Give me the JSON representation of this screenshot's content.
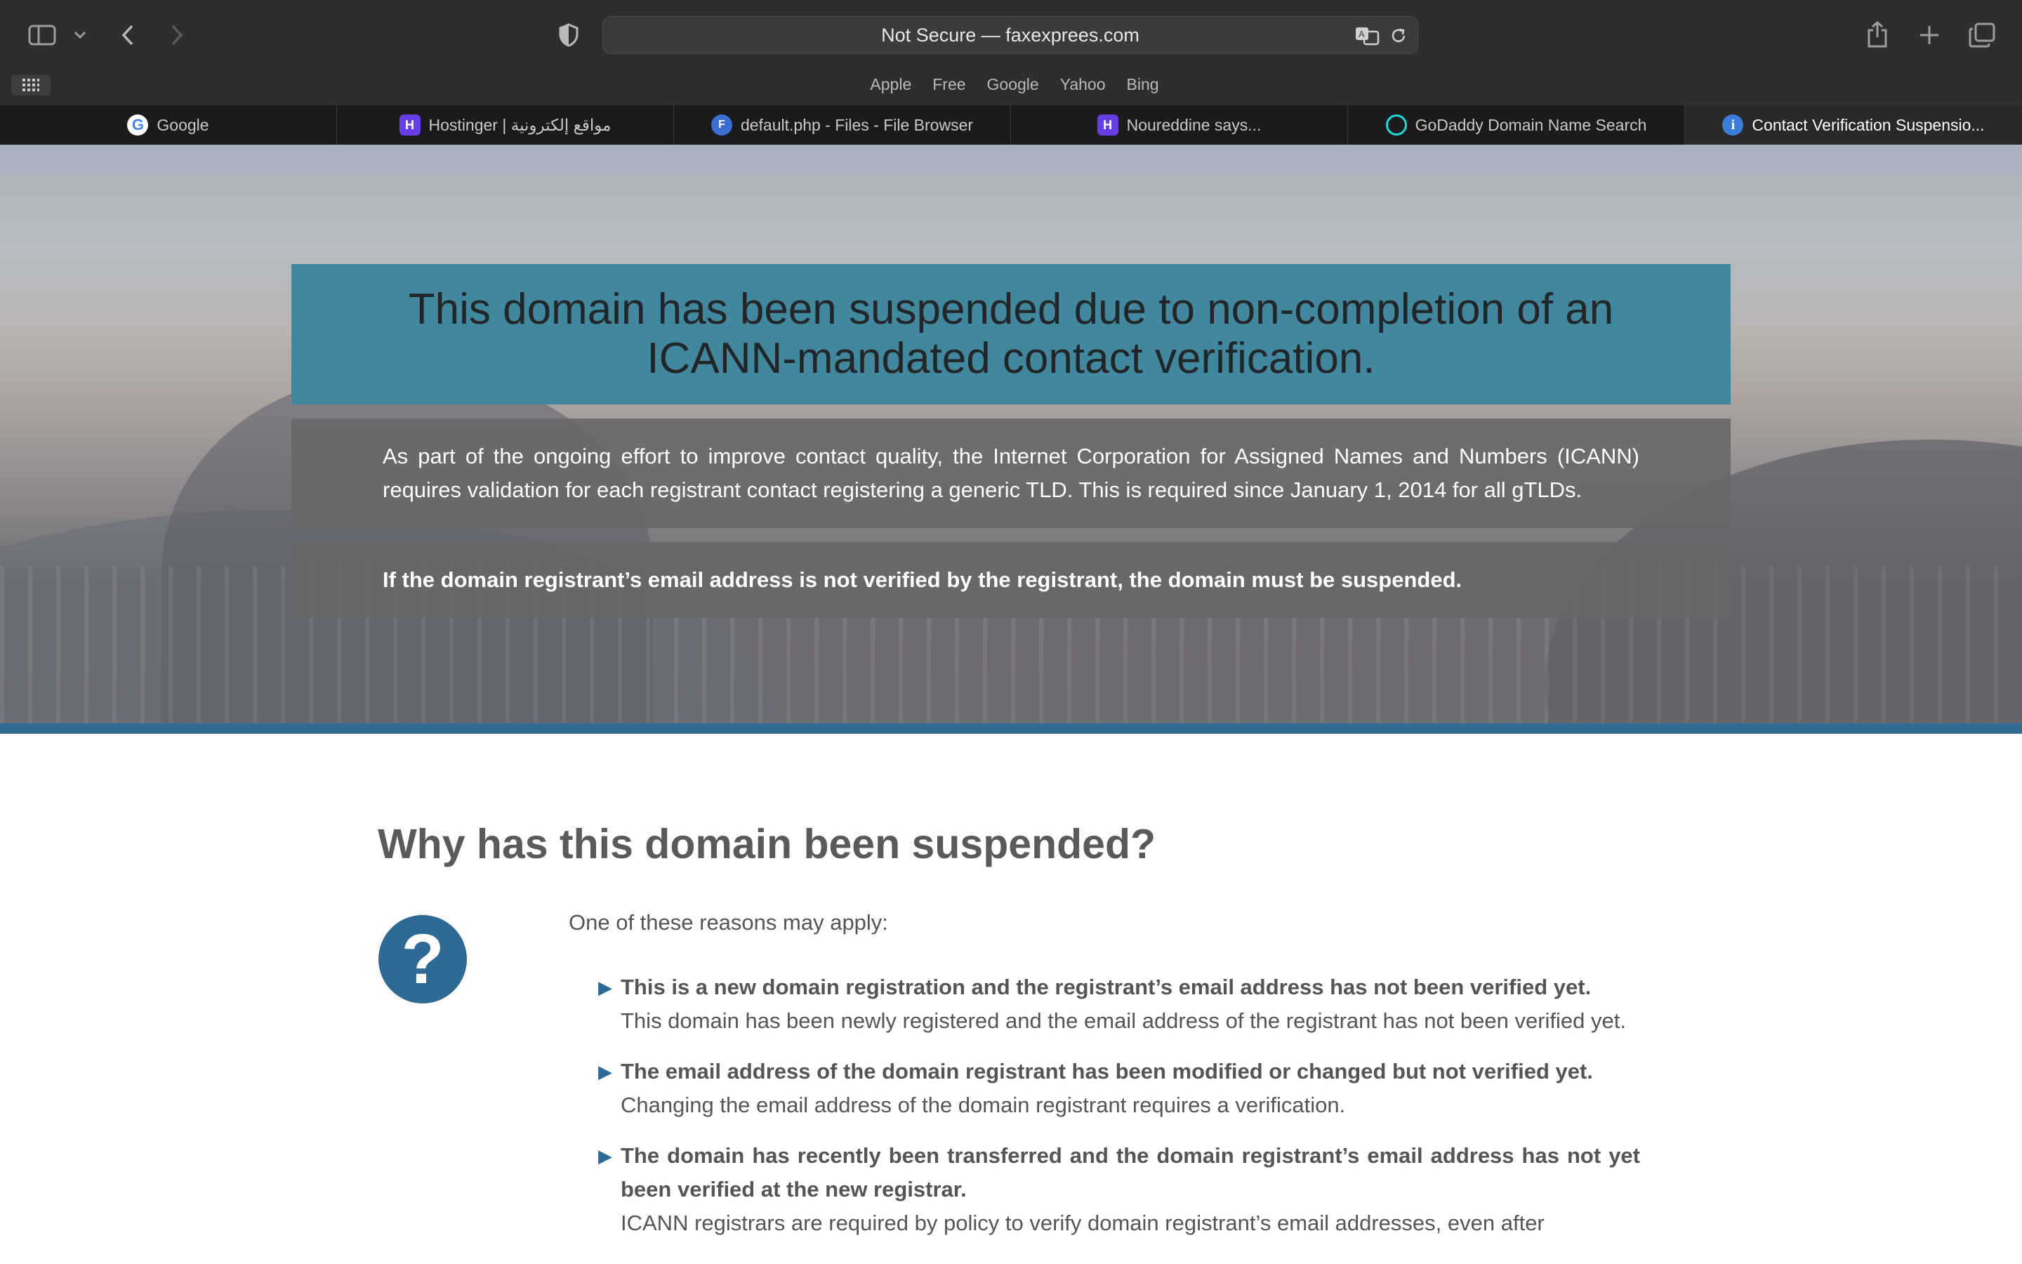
{
  "browser": {
    "address": "Not Secure — faxexprees.com",
    "favorites": [
      "Apple",
      "Free",
      "Google",
      "Yahoo",
      "Bing"
    ],
    "tabs": [
      {
        "title": "Google",
        "icon": "G"
      },
      {
        "title": "Hostinger | مواقع إلكترونية",
        "icon": "H"
      },
      {
        "title": "default.php - Files - File Browser",
        "icon": "F"
      },
      {
        "title": "Noureddine says...",
        "icon": "H"
      },
      {
        "title": "GoDaddy Domain Name Search",
        "icon": ""
      },
      {
        "title": "Contact Verification Suspensio...",
        "icon": "i"
      }
    ]
  },
  "hero": {
    "title": "This domain has been suspended due to non-completion of an ICANN-mandated contact verification.",
    "info": "As part of the ongoing effort to improve contact quality, the Internet Corporation for Assigned Names and Numbers (ICANN) requires validation for each registrant contact registering a generic TLD. This is required since January 1, 2014 for all gTLDs.",
    "warning": "If the domain registrant’s email address is not verified by the registrant, the domain must be suspended."
  },
  "content": {
    "heading": "Why has this domain been suspended?",
    "icon_glyph": "?",
    "intro": "One of these reasons may apply:",
    "bullet": "▶",
    "reasons": [
      {
        "title": "This is a new domain registration and the registrant’s email address has not been verified yet.",
        "text": "This domain has been newly registered and the email address of the registrant has not been verified yet."
      },
      {
        "title": "The email address of the domain registrant has been modified or changed but not verified yet.",
        "text": "Changing the email address of the domain registrant requires a verification."
      },
      {
        "title": "The domain has recently been transferred and the domain registrant’s email address has not yet been verified at the new registrar.",
        "text": "ICANN registrars are required by policy to verify domain registrant’s email addresses, even after"
      }
    ]
  },
  "colors": {
    "accent": "#2e6a93",
    "banner": "#41889f"
  }
}
